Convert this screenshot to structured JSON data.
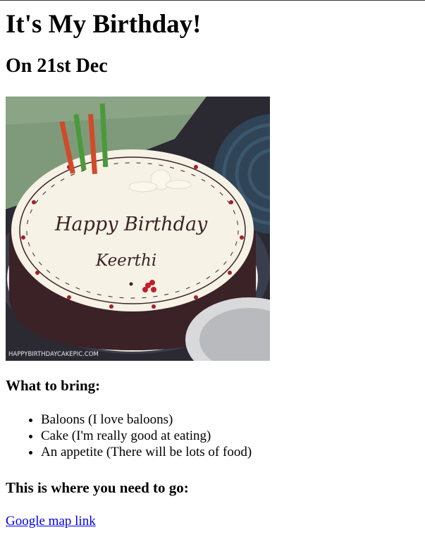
{
  "heading": {
    "title": "It's My Birthday!",
    "date": "On 21st Dec"
  },
  "cake_image": {
    "icon": "birthday-cake-photo",
    "inscription_line1": "Happy Birthday",
    "inscription_line2": "Keerthi",
    "watermark": "HAPPYBIRTHDAYCAKEPIC.COM"
  },
  "bring": {
    "heading": "What to bring:",
    "items": [
      "Baloons (I love baloons)",
      "Cake (I'm really good at eating)",
      "An appetite (There will be lots of food)"
    ]
  },
  "location": {
    "heading": "This is where you need to go:",
    "link_text": "Google map link"
  },
  "colors": {
    "link": "#0000ee",
    "text": "#000000",
    "background": "#ffffff"
  }
}
